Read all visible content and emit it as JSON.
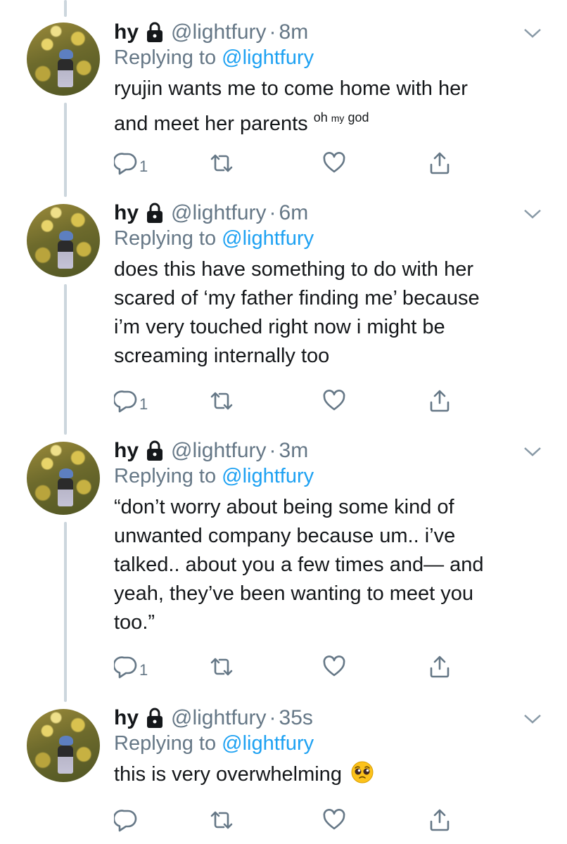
{
  "colors": {
    "text": "#14171a",
    "muted": "#657786",
    "link": "#1da1f2",
    "thread_line": "#ccd6dd"
  },
  "tweets": [
    {
      "display_name": "hy",
      "handle": "@lightfury",
      "dot": "·",
      "time": "8m",
      "replying_prefix": "Replying to ",
      "replying_to": "@lightfury",
      "text_lines": [
        "ryujin wants me to come home with her",
        "and meet her parents "
      ],
      "small_text": {
        "a": "oh ",
        "b": "my",
        "c": " god"
      },
      "reply_count": "1"
    },
    {
      "display_name": "hy",
      "handle": "@lightfury",
      "dot": "·",
      "time": "6m",
      "replying_prefix": "Replying to ",
      "replying_to": "@lightfury",
      "text_lines": [
        "does this have something to do with her",
        "scared of ‘my father finding me’ because",
        "i’m very touched right now i might be",
        "screaming internally too"
      ],
      "reply_count": "1"
    },
    {
      "display_name": "hy",
      "handle": "@lightfury",
      "dot": "·",
      "time": "3m",
      "replying_prefix": "Replying to ",
      "replying_to": "@lightfury",
      "text_lines": [
        "“don’t worry about being some kind of",
        "unwanted company because um.. i’ve",
        "talked.. about you a few times and— and",
        "yeah, they’ve been wanting to meet you",
        "too.”"
      ],
      "reply_count": "1"
    },
    {
      "display_name": "hy",
      "handle": "@lightfury",
      "dot": "·",
      "time": "35s",
      "replying_prefix": "Replying to ",
      "replying_to": "@lightfury",
      "text_lines": [
        "this is very overwhelming "
      ],
      "emoji": "pleading-face-icon",
      "reply_count": ""
    }
  ]
}
